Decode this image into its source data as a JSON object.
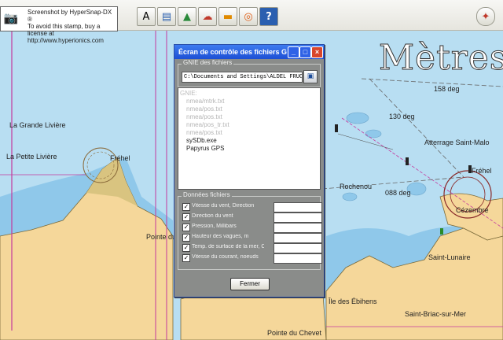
{
  "watermark": {
    "line1": "Screenshot by HyperSnap-DX ®",
    "line2": "To avoid this stamp, buy a license at",
    "line3": "http://www.hyperionics.com"
  },
  "toolbar": {
    "buttons": [
      {
        "name": "text-tool-button",
        "glyph": "A"
      },
      {
        "name": "chart-layers-button",
        "glyph": "▤"
      },
      {
        "name": "tide-button",
        "glyph": "▲"
      },
      {
        "name": "weather-button",
        "glyph": "☁"
      },
      {
        "name": "gps-button",
        "glyph": "▬"
      },
      {
        "name": "lifebuoy-button",
        "glyph": "◎"
      },
      {
        "name": "help-button",
        "glyph": "?"
      }
    ]
  },
  "map": {
    "unit_label": "Mètres",
    "labels": [
      "La Grande Livière",
      "La Petite Livière",
      "Fréhel",
      "158 deg",
      "130 deg",
      "Atterrage Saint-Malo",
      "Fréhel",
      "Rochenou",
      "088 deg",
      "Cézembre",
      "Île des Ébihens",
      "Saint-Lunaire",
      "Saint-Briac-sur-Mer",
      "Pointe du Chevet",
      "Pointe du Décollé"
    ]
  },
  "dialog": {
    "title": "Écran de contrôle des fichiers G...",
    "gnie_group_label": "GNIE des fichiers",
    "path_value": "C:\\Documents and Settings\\ALDEL FRUCTES\\",
    "tree": {
      "root": "GNIE:",
      "items": [
        {
          "label": "nmea/mtrk.txt",
          "enabled": false
        },
        {
          "label": "nmea/pos.txt",
          "enabled": false
        },
        {
          "label": "nmea/pos.txt",
          "enabled": false
        },
        {
          "label": "nmea/pos_tr.txt",
          "enabled": false
        },
        {
          "label": "nmea/pos.txt",
          "enabled": false
        },
        {
          "label": "sySDb.exe",
          "enabled": true
        },
        {
          "label": "Papyrus GPS",
          "enabled": true
        }
      ]
    },
    "data_group_label": "Données fichiers",
    "checks": [
      {
        "label": "Vitesse du vent, Direction",
        "checked": true
      },
      {
        "label": "Direction du vent",
        "checked": true
      },
      {
        "label": "Pression, Millibars",
        "checked": true
      },
      {
        "label": "Hauteur des vagues, m",
        "checked": true
      },
      {
        "label": "Temp. de surface de la mer, C",
        "checked": true
      },
      {
        "label": "Vitesse du courant, noeuds",
        "checked": true
      }
    ],
    "close_label": "Fermer"
  }
}
